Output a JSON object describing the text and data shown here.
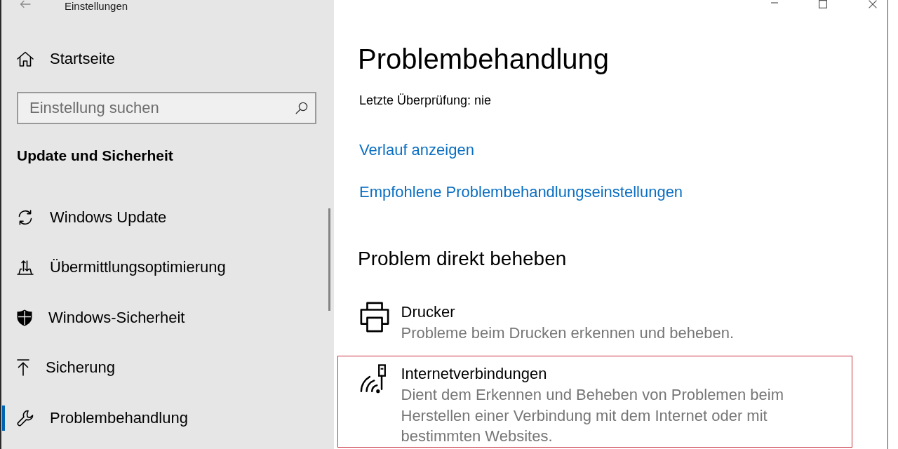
{
  "window": {
    "title": "Einstellungen"
  },
  "sidebar": {
    "home": {
      "label": "Startseite"
    },
    "search": {
      "placeholder": "Einstellung suchen"
    },
    "section_title": "Update und Sicherheit",
    "items": [
      {
        "label": "Windows Update",
        "selected": false
      },
      {
        "label": "Übermittlungsoptimierung",
        "selected": false
      },
      {
        "label": "Windows-Sicherheit",
        "selected": false
      },
      {
        "label": "Sicherung",
        "selected": false
      },
      {
        "label": "Problembehandlung",
        "selected": true
      }
    ]
  },
  "main": {
    "title": "Problembehandlung",
    "last_check": "Letzte Überprüfung: nie",
    "links": [
      "Verlauf anzeigen",
      "Empfohlene Problembehandlungseinstellungen"
    ],
    "section_title": "Problem direkt beheben",
    "troubleshooters": [
      {
        "title": "Drucker",
        "description": "Probleme beim Drucken erkennen und beheben.",
        "highlighted": false
      },
      {
        "title": "Internetverbindungen",
        "description": "Dient dem Erkennen und Beheben von Problemen beim Herstellen einer Verbindung mit dem Internet oder mit bestimmten Websites.",
        "highlighted": true
      }
    ]
  }
}
